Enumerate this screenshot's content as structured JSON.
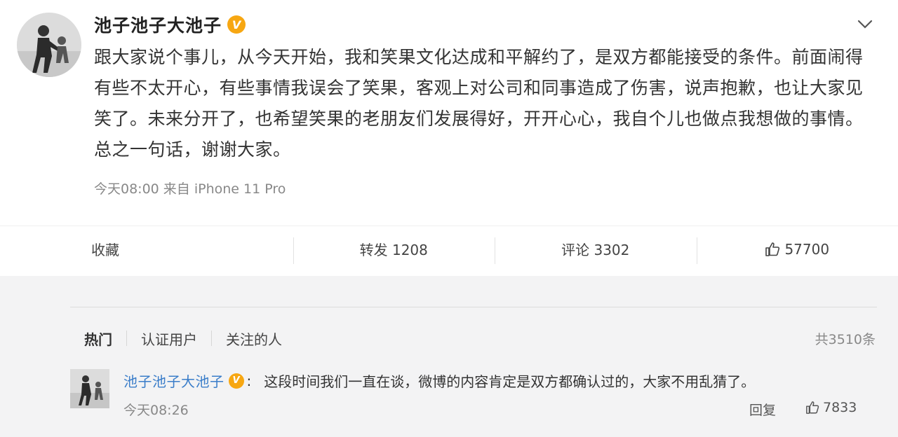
{
  "post": {
    "author": "池子池子大池子",
    "verified_badge": "V",
    "text": "跟大家说个事儿，从今天开始，我和笑果文化达成和平解约了，是双方都能接受的条件。前面闹得有些不太开心，有些事情我误会了笑果，客观上对公司和同事造成了伤害，说声抱歉，也让大家见笑了。未来分开了，也希望笑果的老朋友们发展得好，开开心心，我自个儿也做点我想做的事情。总之一句话，谢谢大家。",
    "meta": "今天08:00  来自 iPhone 11 Pro"
  },
  "actions": {
    "collect": "收藏",
    "repost": "转发 1208",
    "comment": "评论 3302",
    "like": "57700"
  },
  "comments": {
    "tabs": [
      "热门",
      "认证用户",
      "关注的人"
    ],
    "count": "共3510条",
    "items": [
      {
        "author": "池子池子大池子",
        "badge": "V",
        "colon": ":",
        "text": "这段时间我们一直在谈，微博的内容肯定是双方都确认过的，大家不用乱猜了。",
        "time": "今天08:26",
        "reply": "回复",
        "likes": "7833"
      }
    ]
  },
  "colors": {
    "name_link": "#3a7dc9",
    "badge": "#f7a712",
    "muted": "#888888"
  },
  "icons": {
    "expand": "chevron-down-icon",
    "like": "thumbs-up-icon"
  }
}
